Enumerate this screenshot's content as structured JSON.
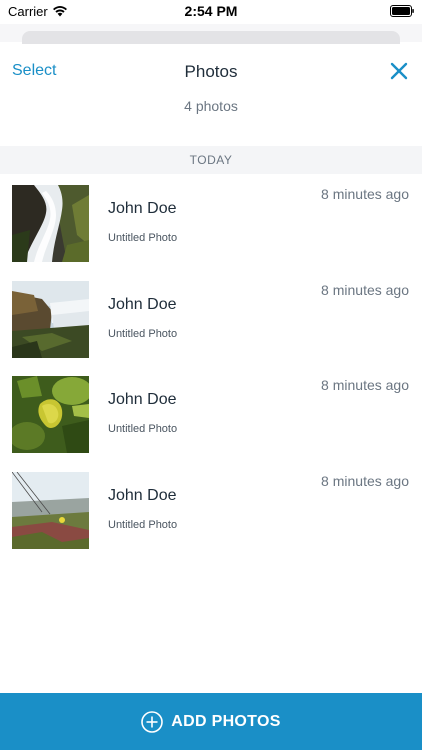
{
  "status_bar": {
    "carrier": "Carrier",
    "time": "2:54 PM"
  },
  "header": {
    "select_label": "Select",
    "title": "Photos",
    "close_icon": "close-icon",
    "photo_count": "4 photos"
  },
  "section": {
    "label": "TODAY"
  },
  "photos": [
    {
      "author": "John Doe",
      "caption": "Untitled Photo",
      "time": "8 minutes ago",
      "thumb": "waterfall"
    },
    {
      "author": "John Doe",
      "caption": "Untitled Photo",
      "time": "8 minutes ago",
      "thumb": "falls-landscape"
    },
    {
      "author": "John Doe",
      "caption": "Untitled Photo",
      "time": "8 minutes ago",
      "thumb": "leaves"
    },
    {
      "author": "John Doe",
      "caption": "Untitled Photo",
      "time": "8 minutes ago",
      "thumb": "grass-field"
    }
  ],
  "footer": {
    "add_label": "ADD PHOTOS",
    "icon": "plus-circle-icon"
  },
  "colors": {
    "accent": "#1a8fc7",
    "text": "#1f2d3a",
    "muted": "#6b7682"
  }
}
